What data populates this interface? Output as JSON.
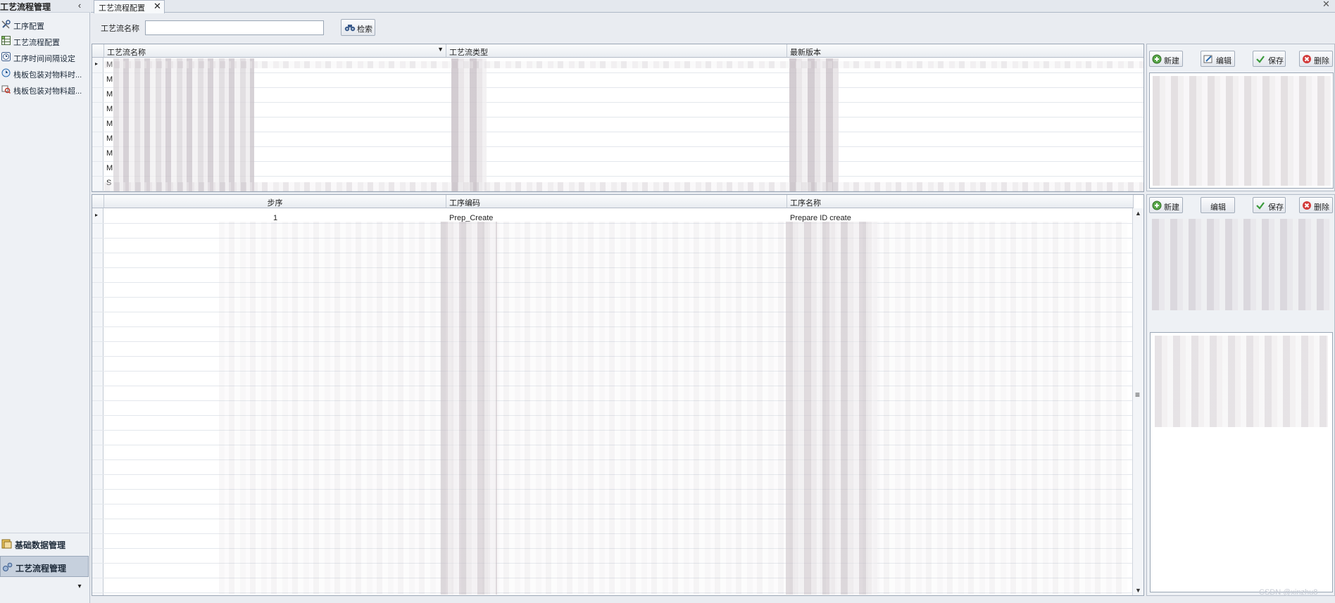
{
  "nav": {
    "title": "工艺流程管理",
    "collapse_glyph": "‹",
    "items": [
      {
        "label": "工序配置",
        "icon": "tools-icon"
      },
      {
        "label": "工艺流程配置",
        "icon": "grid-config-icon"
      },
      {
        "label": "工序时间间隔设定",
        "icon": "clock-icon"
      },
      {
        "label": "栈板包装对物料时...",
        "icon": "box-clock-icon"
      },
      {
        "label": "栈板包装对物料超...",
        "icon": "box-search-icon"
      }
    ],
    "groups": [
      {
        "label": "基础数据管理",
        "icon": "database-icon"
      },
      {
        "label": "工艺流程管理",
        "icon": "gears-icon"
      }
    ],
    "more_glyph": "▾"
  },
  "tab": {
    "label": "工艺流程配置",
    "close": "✕"
  },
  "window_close": "✕",
  "search": {
    "label": "工艺流名称",
    "value": "",
    "placeholder": "",
    "button_label": "检索"
  },
  "top_grid": {
    "columns": [
      "工艺流名称",
      "工艺流类型",
      "最新版本"
    ],
    "rows": [
      "M",
      "M",
      "M",
      "M",
      "M",
      "M",
      "M",
      "M",
      "S"
    ]
  },
  "bottom_grid": {
    "columns": [
      "步序",
      "工序编码",
      "工序名称"
    ],
    "first_row": {
      "step": "1",
      "code": "Prep_Create",
      "name": "Prepare ID create"
    }
  },
  "right_panel_top": {
    "buttons": [
      "新建",
      "编辑",
      "保存",
      "删除"
    ]
  },
  "right_panel_bottom": {
    "buttons": [
      "新建",
      "编辑",
      "保存",
      "删除"
    ]
  },
  "watermark": "CSDN @xinzhu8",
  "colors": {
    "accent": "#2b6cb0",
    "save_green": "#3a9a3a",
    "delete_red": "#d23b3b"
  }
}
